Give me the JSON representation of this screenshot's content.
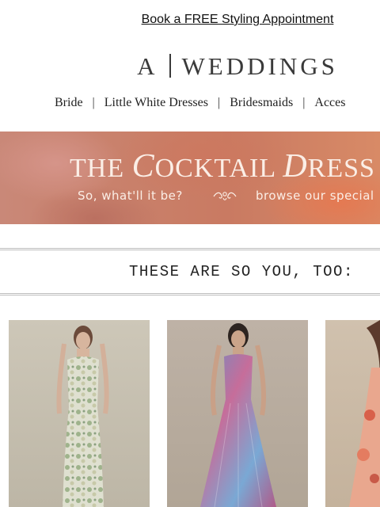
{
  "header": {
    "appointment_link": "Book a FREE Styling Appointment",
    "logo_left": "A",
    "logo_right": "WEDDINGS"
  },
  "nav": {
    "items": [
      "Bride",
      "Little White Dresses",
      "Bridesmaids",
      "Acces"
    ],
    "separator": "|"
  },
  "banner": {
    "title_prefix": "THE ",
    "title_c": "C",
    "title_ocktail": "OCKTAIL ",
    "title_d": "D",
    "title_ress": "RESS ED",
    "subtitle_left": "So, what'll it be?",
    "subtitle_right": "browse our special",
    "colors": {
      "accent": "#c97a62",
      "text": "#fbeee6"
    }
  },
  "section": {
    "title": "THESE ARE SO YOU, TOO:"
  },
  "products": [
    {
      "image": "cream and green floral jacquard strapless gown"
    },
    {
      "image": "blue and pink floral pleated gown"
    },
    {
      "image": "coral floral gown (cropped)"
    }
  ]
}
